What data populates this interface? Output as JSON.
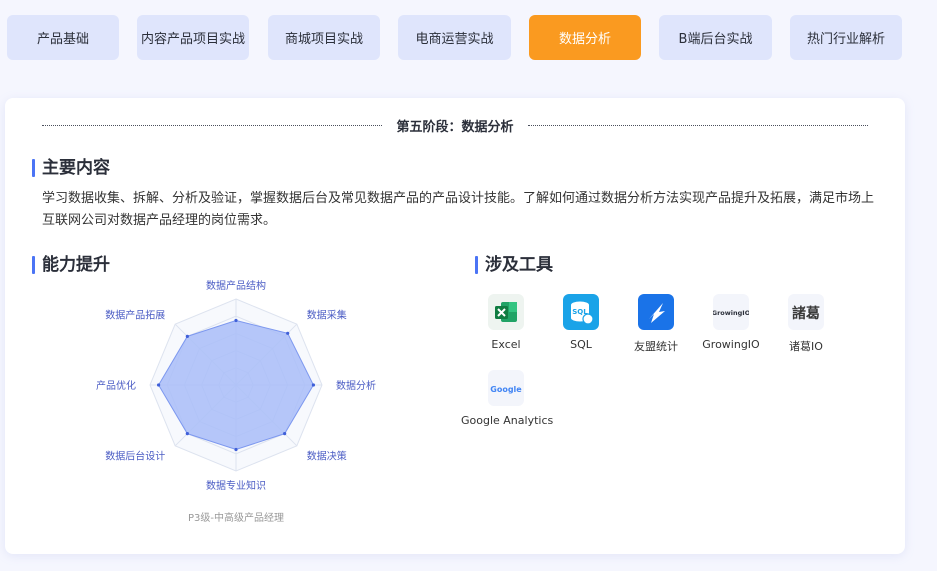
{
  "tabs": [
    {
      "label": "产品基础",
      "active": false
    },
    {
      "label": "内容产品项目实战",
      "active": false
    },
    {
      "label": "商城项目实战",
      "active": false
    },
    {
      "label": "电商运营实战",
      "active": false
    },
    {
      "label": "数据分析",
      "active": true
    },
    {
      "label": "B端后台实战",
      "active": false
    },
    {
      "label": "热门行业解析",
      "active": false
    }
  ],
  "stage_title": "第五阶段：数据分析",
  "main_content": {
    "title": "主要内容",
    "description": "学习数据收集、拆解、分析及验证，掌握数据后台及常见数据产品的产品设计技能。了解如何通过数据分析方法实现产品提升及拓展，满足市场上互联网公司对数据产品经理的岗位需求。"
  },
  "ability": {
    "title": "能力提升",
    "caption": "P3级-中高级产品经理",
    "colors": {
      "fill": "#a9bdf8",
      "stroke": "#7d98ef",
      "label": "#4b5cc4",
      "grid": "#dde3ef"
    }
  },
  "chart_data": {
    "type": "radar",
    "categories": [
      "数据产品结构",
      "数据采集",
      "数据分析",
      "数据决策",
      "数据专业知识",
      "数据后台设计",
      "产品优化",
      "数据产品拓展"
    ],
    "values": [
      0.75,
      0.85,
      0.9,
      0.8,
      0.75,
      0.8,
      0.9,
      0.8
    ],
    "max": 1
  },
  "tools": {
    "title": "涉及工具",
    "items": [
      {
        "label": "Excel",
        "icon": "excel-icon",
        "color": "#1d7044"
      },
      {
        "label": "SQL",
        "icon": "sql-icon",
        "color": "#1aa3e8"
      },
      {
        "label": "友盟统计",
        "icon": "umeng-icon",
        "color": "#1a73e8"
      },
      {
        "label": "GrowingIO",
        "icon": "growingio-icon",
        "color": "#2b2f3a"
      },
      {
        "label": "诸葛IO",
        "icon": "zhuge-icon",
        "color": "#3a3a3a"
      },
      {
        "label": "Google Analytics",
        "icon": "google-icon",
        "color": "#4285f4"
      }
    ],
    "icon_text": {
      "growingio": "GrowingIO",
      "google": "Google",
      "zhuge": "諸葛",
      "sql": "SQL"
    }
  }
}
